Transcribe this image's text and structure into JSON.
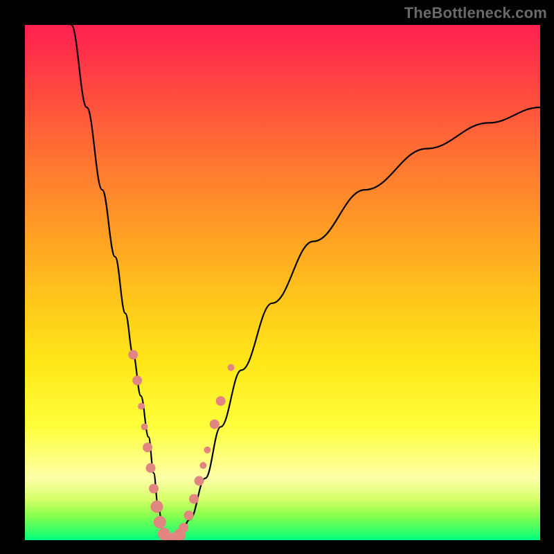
{
  "watermark": "TheBottleneck.com",
  "chart_data": {
    "type": "line",
    "title": "",
    "xlabel": "",
    "ylabel": "",
    "xlim": [
      0,
      100
    ],
    "ylim": [
      0,
      100
    ],
    "grid": false,
    "legend": false,
    "background": "rainbow-gradient red→green (top→bottom)",
    "series": [
      {
        "name": "curve",
        "color": "#000000",
        "x": [
          9,
          12,
          15,
          17.5,
          19.5,
          21,
          22.5,
          24,
          25,
          25.8,
          26.8,
          28.4,
          30,
          32,
          35,
          38,
          42,
          48,
          56,
          66,
          78,
          90,
          100
        ],
        "values": [
          100,
          84,
          68,
          55,
          44,
          36,
          28,
          20,
          13,
          7,
          2,
          0,
          0.8,
          4,
          12,
          22,
          33,
          46,
          58,
          68,
          76,
          81,
          84
        ]
      }
    ],
    "markers": {
      "name": "highlighted-points",
      "color": "#e08580",
      "points": [
        {
          "x": 21.0,
          "y": 36,
          "size": "med"
        },
        {
          "x": 21.8,
          "y": 31,
          "size": "med"
        },
        {
          "x": 22.6,
          "y": 26,
          "size": "small"
        },
        {
          "x": 23.2,
          "y": 22,
          "size": "small"
        },
        {
          "x": 23.8,
          "y": 18,
          "size": "med"
        },
        {
          "x": 24.4,
          "y": 14,
          "size": "med"
        },
        {
          "x": 25.0,
          "y": 10,
          "size": "med"
        },
        {
          "x": 25.6,
          "y": 6.5,
          "size": "big"
        },
        {
          "x": 26.2,
          "y": 3.5,
          "size": "big"
        },
        {
          "x": 27.0,
          "y": 1.2,
          "size": "big"
        },
        {
          "x": 28.0,
          "y": 0.2,
          "size": "big"
        },
        {
          "x": 29.0,
          "y": 0.3,
          "size": "big"
        },
        {
          "x": 30.0,
          "y": 1.0,
          "size": "big"
        },
        {
          "x": 30.8,
          "y": 2.4,
          "size": "med"
        },
        {
          "x": 31.8,
          "y": 4.8,
          "size": "med"
        },
        {
          "x": 32.8,
          "y": 8.0,
          "size": "med"
        },
        {
          "x": 33.8,
          "y": 11.5,
          "size": "med"
        },
        {
          "x": 34.6,
          "y": 14.5,
          "size": "small"
        },
        {
          "x": 35.4,
          "y": 17.5,
          "size": "small"
        },
        {
          "x": 36.8,
          "y": 22.5,
          "size": "med"
        },
        {
          "x": 38.0,
          "y": 27,
          "size": "med"
        },
        {
          "x": 40.0,
          "y": 33.5,
          "size": "small"
        }
      ]
    }
  }
}
